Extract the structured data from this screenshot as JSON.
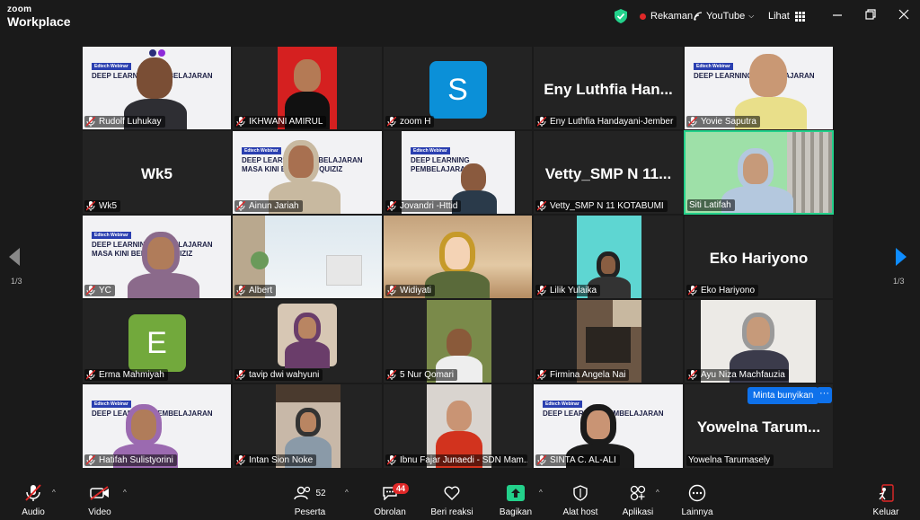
{
  "app": {
    "logo_top": "zoom",
    "logo_bottom": "Workplace"
  },
  "titlebar": {
    "recording": "Rekaman",
    "youtube": "YouTube",
    "view": "Lihat"
  },
  "colors": {
    "accent": "#0e71eb",
    "active_speaker": "#23d18b",
    "record": "#e02828",
    "share": "#23d18b"
  },
  "gallery": {
    "tiles": [
      {
        "name": "Rudolf Luhukay",
        "big": ""
      },
      {
        "name": "IKHWANI AMIRUL",
        "big": ""
      },
      {
        "name": "zoom H",
        "big": "",
        "avatar_letter": "S"
      },
      {
        "name": "Eny Luthfia Handayani-Jember",
        "big": "Eny Luthfia Han..."
      },
      {
        "name": "Yovie Saputra",
        "big": ""
      },
      {
        "name": "Wk5",
        "big": "Wk5"
      },
      {
        "name": "Ainun Jariah",
        "big": ""
      },
      {
        "name": "Jovandri -Httid",
        "big": ""
      },
      {
        "name": "Vetty_SMP N 11 KOTABUMI",
        "big": "Vetty_SMP N 11..."
      },
      {
        "name": "Siti Latifah",
        "big": ""
      },
      {
        "name": "YC",
        "big": ""
      },
      {
        "name": "Albert",
        "big": ""
      },
      {
        "name": "Widiyati",
        "big": ""
      },
      {
        "name": "Lilik Yulaika",
        "big": ""
      },
      {
        "name": "Eko Hariyono",
        "big": "Eko Hariyono"
      },
      {
        "name": "Erma Mahmiyah",
        "big": "",
        "avatar_letter": "E"
      },
      {
        "name": "tavip dwi wahyuni",
        "big": ""
      },
      {
        "name": "5 Nur Qomari",
        "big": ""
      },
      {
        "name": "Firmina Angela Nai",
        "big": ""
      },
      {
        "name": "Ayu Niza Machfauzia",
        "big": ""
      },
      {
        "name": "Hatifah Sulistyorini",
        "big": ""
      },
      {
        "name": "Intan Sion Noke",
        "big": ""
      },
      {
        "name": "Ibnu Fajar Junaedi - SDN Mam...",
        "big": ""
      },
      {
        "name": "SINTA C. AL-ALI",
        "big": ""
      },
      {
        "name": "Yowelna Tarumasely",
        "big": "Yowelna Tarum..."
      }
    ],
    "slide_tag": "Edtech Webinar",
    "slide_title_1": "DEEP LEARNING PEMBELAJARAN",
    "slide_title_2": "MASA KINI BERSAMA QUIZIZ",
    "page_left": "1/3",
    "page_right": "1/3",
    "ask_unmute": "Minta bunyikan",
    "ask_more": "···"
  },
  "toolbar": {
    "audio": "Audio",
    "video": "Video",
    "participants": "Peserta",
    "participants_count": "52",
    "chat": "Obrolan",
    "chat_badge": "44",
    "reactions": "Beri reaksi",
    "share": "Bagikan",
    "host_tools": "Alat host",
    "apps": "Aplikasi",
    "more": "Lainnya",
    "leave": "Keluar"
  }
}
